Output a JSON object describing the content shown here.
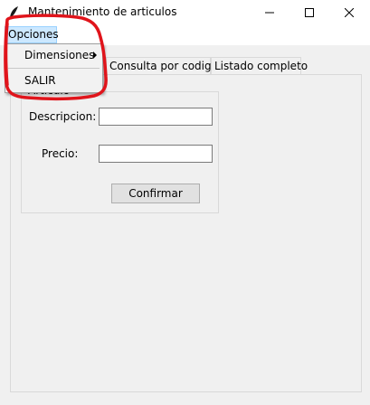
{
  "window": {
    "title": "Mantenimiento de articulos",
    "icon": "feather-icon",
    "controls": {
      "minimize": "minimize-icon",
      "maximize": "maximize-icon",
      "close": "close-icon"
    }
  },
  "menubar": {
    "items": [
      {
        "label": "Opciones",
        "state": "open"
      }
    ]
  },
  "dropdown": {
    "items": [
      {
        "label": "Dimensiones",
        "has_submenu": true
      },
      {
        "label": "SALIR",
        "has_submenu": false
      }
    ]
  },
  "tabs": [
    {
      "label": ""
    },
    {
      "label": "Consulta por codigo"
    },
    {
      "label": "Listado completo"
    }
  ],
  "form": {
    "group_label": "Articulo",
    "descripcion_label": "Descripcion:",
    "descripcion_value": "",
    "precio_label": "Precio:",
    "precio_value": "",
    "confirm_label": "Confirmar"
  },
  "annotation": {
    "color": "#e0141b",
    "shape": "hand-drawn-outline"
  },
  "colors": {
    "menu_highlight": "#cce8ff",
    "menu_highlight_border": "#99d1ff",
    "window_bg": "#f0f0f0",
    "titlebar_bg": "#ffffff"
  }
}
